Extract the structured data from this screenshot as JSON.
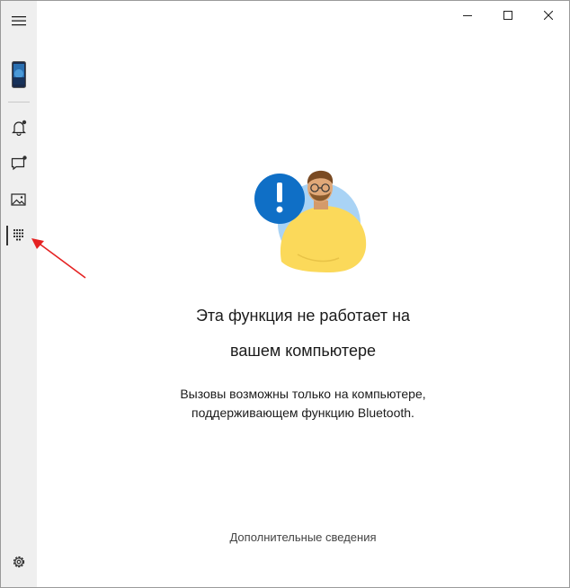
{
  "sidebar": {
    "items": [
      {
        "name": "menu-icon"
      },
      {
        "name": "phone-thumbnail"
      },
      {
        "name": "notifications-icon",
        "badge": true
      },
      {
        "name": "messages-icon",
        "badge": true
      },
      {
        "name": "photos-icon"
      },
      {
        "name": "dialpad-icon",
        "active": true
      }
    ],
    "settings_icon": "gear-icon"
  },
  "titlebar": {
    "minimize_icon": "minimize-icon",
    "maximize_icon": "maximize-icon",
    "close_icon": "close-icon"
  },
  "main": {
    "heading_line1": "Эта функция не работает на",
    "heading_line2": "вашем компьютере",
    "body_line1": "Вызовы возможны только на компьютере,",
    "body_line2": "поддерживающем функцию Bluetooth.",
    "more_info_link": "Дополнительные сведения"
  },
  "colors": {
    "accent_blue": "#0f6fc6",
    "annotation_red": "#e52222",
    "figure_yellow": "#fbd95a",
    "sidebar_bg": "#efefef"
  }
}
